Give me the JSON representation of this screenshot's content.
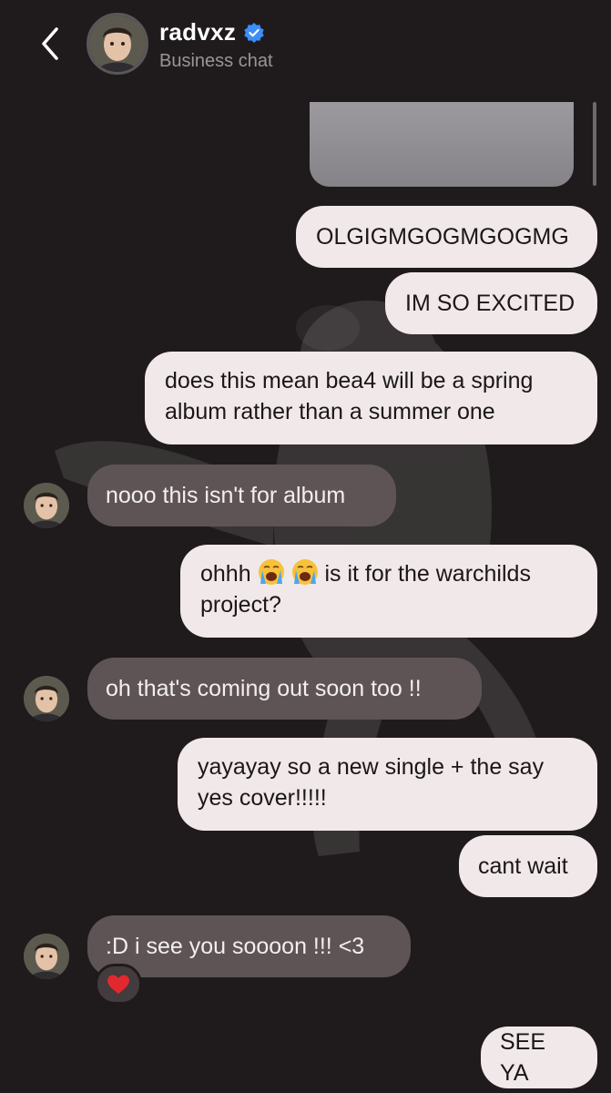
{
  "header": {
    "back_icon": "chevron-left-icon",
    "contact_name": "radvxz",
    "verified_icon": "verified-badge-icon",
    "subtitle": "Business chat"
  },
  "colors": {
    "background": "#1f1b1c",
    "outgoing_bubble": "#f1e8ea",
    "incoming_bubble": "#5e5456",
    "verified_blue": "#3d8ef6"
  },
  "messages": [
    {
      "side": "out",
      "text": "OLGIGMGOGMGOGMG"
    },
    {
      "side": "out",
      "text": "IM SO EXCITED"
    },
    {
      "side": "out",
      "line1": "does this mean bea4 will be a spring",
      "line2": "album rather than a summer one"
    },
    {
      "side": "in",
      "text": "nooo this isn't for album"
    },
    {
      "side": "out",
      "line1_a": "ohhh",
      "line1_b": "is it for the warchilds",
      "line2": "project?",
      "emoji": "loudly-crying-face-icon"
    },
    {
      "side": "in",
      "text": "oh that's coming out soon too !!"
    },
    {
      "side": "out",
      "line1": "yayayay so a new single + the say",
      "line2": "yes cover!!!!!"
    },
    {
      "side": "out",
      "text": "cant wait"
    },
    {
      "side": "in",
      "text": ":D i see you soooon !!! <3",
      "reaction": "red-heart-icon"
    },
    {
      "side": "out",
      "text": "SEE YA"
    }
  ]
}
